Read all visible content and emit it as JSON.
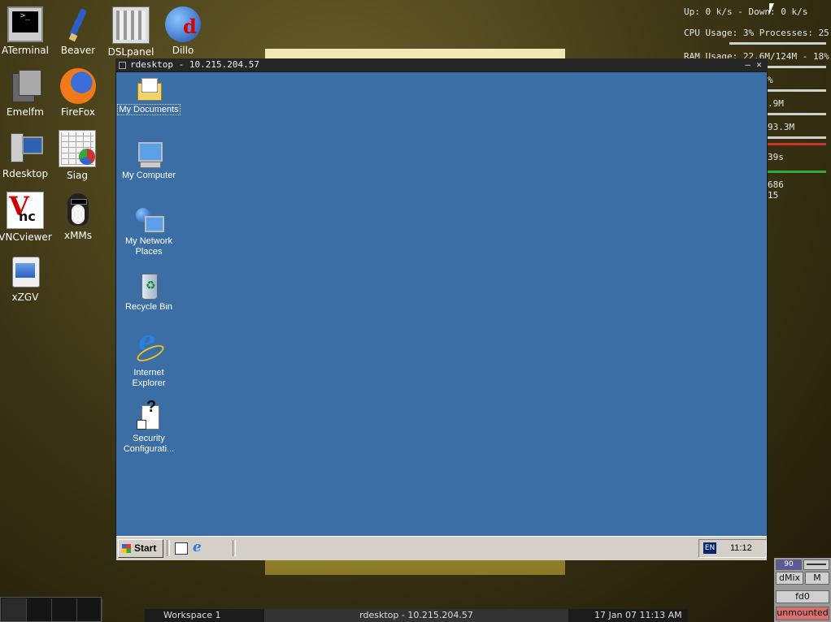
{
  "desktop": {
    "icons": [
      {
        "label": "ATerminal"
      },
      {
        "label": "Beaver"
      },
      {
        "label": "DSLpanel"
      },
      {
        "label": "Dillo"
      },
      {
        "label": "Emelfm"
      },
      {
        "label": "FireFox"
      },
      {
        "label": "Rdesktop"
      },
      {
        "label": "Siag"
      },
      {
        "label": "VNCviewer"
      },
      {
        "label": "xMMs"
      },
      {
        "label": "xZGV"
      }
    ]
  },
  "conky": {
    "net": "Up: 0 k/s - Down: 0 k/s",
    "cpu": "CPU Usage: 3% Processes: 25",
    "ram": "RAM Usage: 22.6M/124M - 18%",
    "l4": "%",
    "l5": ".9M",
    "l6": "93.3M",
    "l7": "39s",
    "l8": "686",
    "l9": "15"
  },
  "window": {
    "title": "rdesktop - 10.215.204.57",
    "icons": [
      {
        "label": "My Documents"
      },
      {
        "label": "My Computer"
      },
      {
        "label": "My Network Places"
      },
      {
        "label": "Recycle Bin"
      },
      {
        "label": "Internet Explorer"
      },
      {
        "label": "Security Configurati..."
      }
    ],
    "taskbar": {
      "start": "Start",
      "lang": "EN",
      "clock": "11:12"
    }
  },
  "bottombar": {
    "workspace": "Workspace 1",
    "task": "rdesktop - 10.215.204.57",
    "datetime": "17 Jan 07 11:13 AM"
  },
  "dock": {
    "vol": "90",
    "mixer": "dMix",
    "mixer_btn": "M",
    "drive": "fd0",
    "state": "unmounted"
  },
  "colors": {
    "remote_bg": "#3a6ea5",
    "taskbar": "#d4d0c8",
    "unmounted": "#d8706e"
  }
}
